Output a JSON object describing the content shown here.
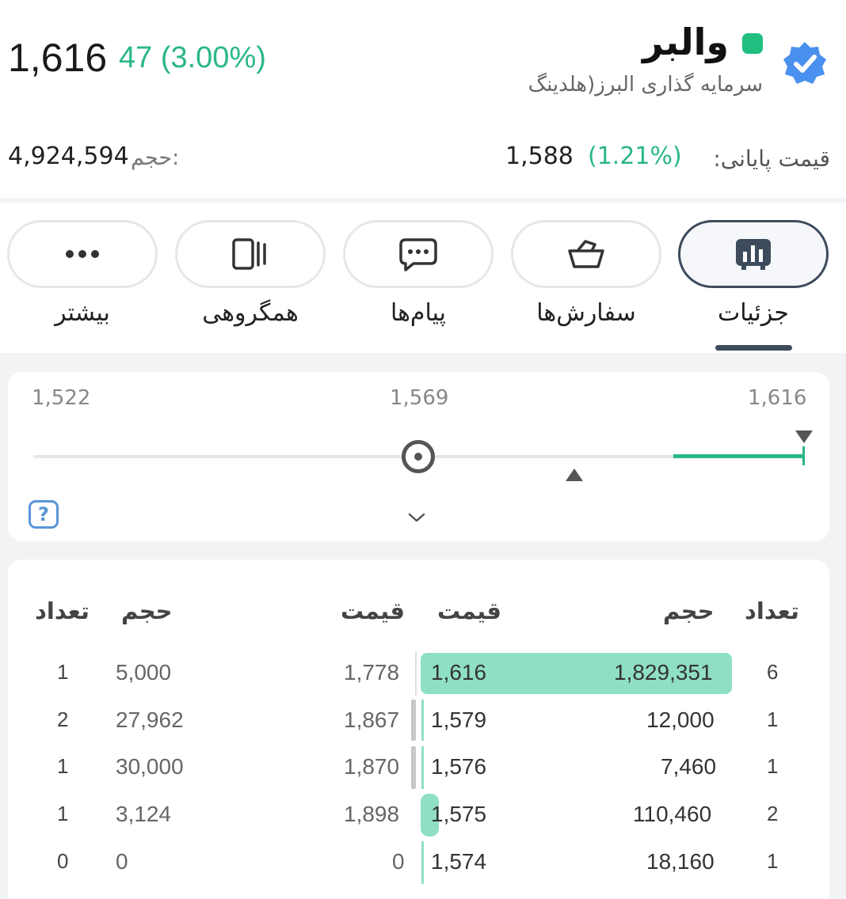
{
  "header": {
    "last_price": "1,616",
    "change": "47 (3.00%)",
    "symbol": "والبر",
    "company": "سرمایه گذاری البرز(هلدینگ",
    "volume_label": "حجم:",
    "volume_value": "4,924,594",
    "close_label": "قیمت پایانی:",
    "close_pct": "(1.21%)",
    "close_value": "1,588",
    "colors": {
      "positive": "#2ab68a",
      "status": "#1fbf80",
      "verified": "#3f8cf0"
    }
  },
  "tabs": [
    {
      "label": "جزئیات",
      "icon": "bar-chart-icon",
      "active": true
    },
    {
      "label": "سفارش‌ها",
      "icon": "basket-icon",
      "active": false
    },
    {
      "label": "پیام‌ها",
      "icon": "chat-icon",
      "active": false
    },
    {
      "label": "همگروهی",
      "icon": "group-icon",
      "active": false
    },
    {
      "label": "بیشتر",
      "icon": "more-icon",
      "active": false
    }
  ],
  "range": {
    "low": "1,522",
    "mid": "1,569",
    "high": "1,616",
    "help": "?"
  },
  "order_book": {
    "headers": {
      "sell_count": "تعداد",
      "sell_volume": "حجم",
      "sell_price": "قیمت",
      "buy_price": "قیمت",
      "buy_volume": "حجم",
      "buy_count": "تعداد"
    },
    "rows": [
      {
        "sell_count": "1",
        "sell_volume": "5,000",
        "sell_price": "1,778",
        "buy_price": "1,616",
        "buy_volume": "1,829,351",
        "buy_count": "6"
      },
      {
        "sell_count": "2",
        "sell_volume": "27,962",
        "sell_price": "1,867",
        "buy_price": "1,579",
        "buy_volume": "12,000",
        "buy_count": "1"
      },
      {
        "sell_count": "1",
        "sell_volume": "30,000",
        "sell_price": "1,870",
        "buy_price": "1,576",
        "buy_volume": "7,460",
        "buy_count": "1"
      },
      {
        "sell_count": "1",
        "sell_volume": "3,124",
        "sell_price": "1,898",
        "buy_price": "1,575",
        "buy_volume": "110,460",
        "buy_count": "2"
      },
      {
        "sell_count": "0",
        "sell_volume": "0",
        "sell_price": "0",
        "buy_price": "1,574",
        "buy_volume": "18,160",
        "buy_count": "1"
      }
    ]
  }
}
